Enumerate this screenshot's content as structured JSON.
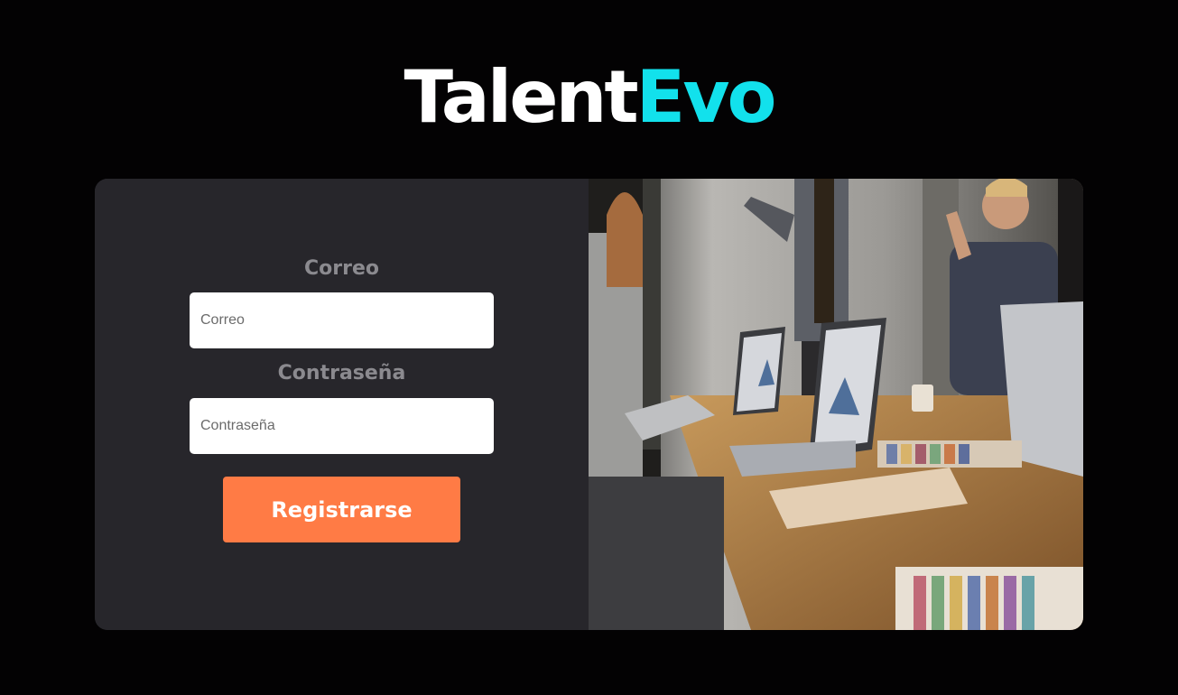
{
  "brand": {
    "name_part1": "Talent",
    "name_part2": "Evo",
    "accent_color": "#12e1ec"
  },
  "form": {
    "email_label": "Correo",
    "email_placeholder": "Correo",
    "password_label": "Contraseña",
    "password_placeholder": "Contraseña",
    "submit_label": "Registrarse",
    "submit_color": "#ff7b45"
  },
  "photo": {
    "subject": "team-meeting-photo"
  }
}
